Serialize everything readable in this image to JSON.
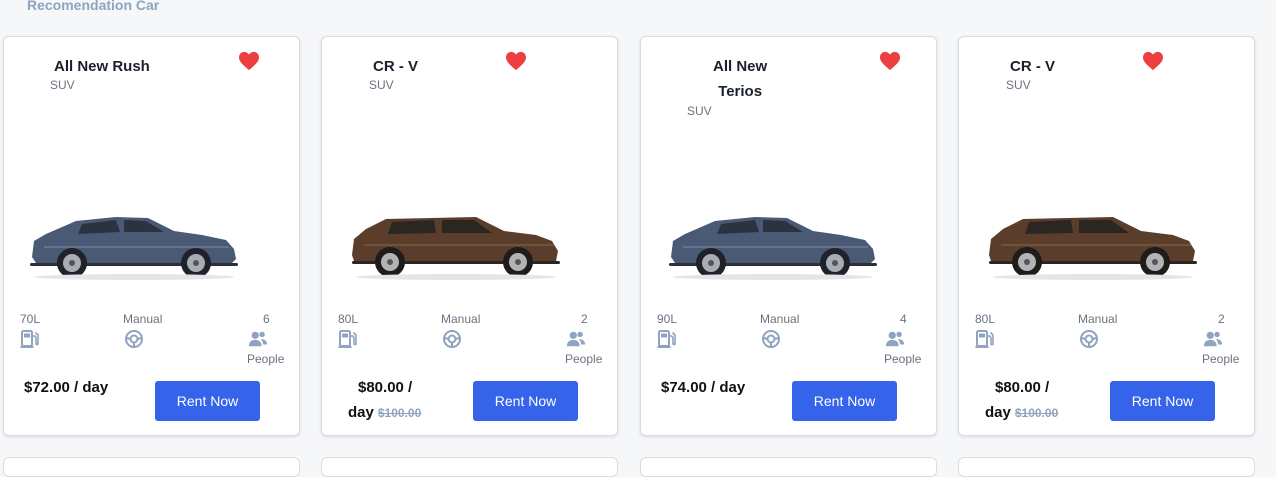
{
  "section": {
    "title": "Recomendation Car"
  },
  "colors": {
    "accent": "#3563e9",
    "heart": "#ed3f3f",
    "muted": "#90a3bf",
    "icon": "#90a3bf",
    "car_blue": "#4a5a75",
    "car_brown": "#5a3e2b"
  },
  "cars": [
    {
      "name": "All New Rush",
      "type": "SUV",
      "fuel": "70L",
      "transmission": "Manual",
      "capacity": "6",
      "capacity_unit": "People",
      "price": "$72.00 / day",
      "old_price": "",
      "button": "Rent Now",
      "favorite_icon": "heart-icon",
      "car_color": "blue"
    },
    {
      "name": "CR - V",
      "type": "SUV",
      "fuel": "80L",
      "transmission": "Manual",
      "capacity": "2",
      "capacity_unit": "People",
      "price_line1": "$80.00 /",
      "price_line2": "day",
      "old_price": "$100.00",
      "button": "Rent Now",
      "favorite_icon": "heart-icon",
      "car_color": "brown"
    },
    {
      "name_line1": "All New",
      "name_line2": "Terios",
      "type": "SUV",
      "fuel": "90L",
      "transmission": "Manual",
      "capacity": "4",
      "capacity_unit": "People",
      "price": "$74.00 / day",
      "old_price": "",
      "button": "Rent Now",
      "favorite_icon": "heart-icon",
      "car_color": "blue"
    },
    {
      "name": "CR - V",
      "type": "SUV",
      "fuel": "80L",
      "transmission": "Manual",
      "capacity": "2",
      "capacity_unit": "People",
      "price_line1": "$80.00 /",
      "price_line2": "day",
      "old_price": "$100.00",
      "button": "Rent Now",
      "favorite_icon": "heart-icon",
      "car_color": "brown"
    }
  ]
}
